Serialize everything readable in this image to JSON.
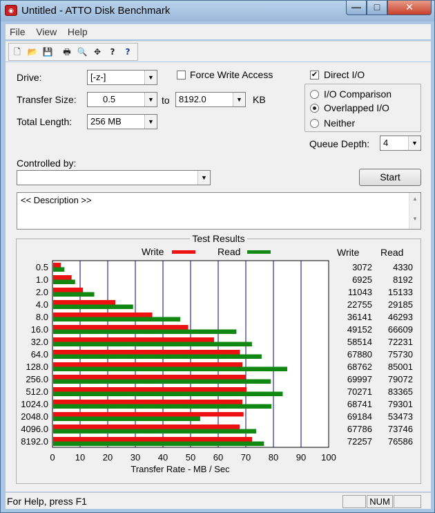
{
  "window": {
    "title": "Untitled - ATTO Disk Benchmark",
    "controls": {
      "minimize": "—",
      "maximize": "□",
      "close": "✕"
    }
  },
  "menu": [
    {
      "label": "File"
    },
    {
      "label": "View"
    },
    {
      "label": "Help"
    }
  ],
  "toolbar": {
    "buttons": [
      {
        "icon": "new-document-icon",
        "glyph": "🗋"
      },
      {
        "icon": "open-folder-icon",
        "glyph": "📂"
      },
      {
        "icon": "save-icon",
        "glyph": "💾"
      },
      {
        "icon": "print-icon",
        "glyph": "🖶"
      },
      {
        "icon": "print-preview-icon",
        "glyph": "🔍"
      },
      {
        "icon": "move-icon",
        "glyph": "✥"
      },
      {
        "icon": "help-icon",
        "glyph": "?"
      },
      {
        "icon": "context-help-icon",
        "glyph": "?"
      }
    ]
  },
  "form": {
    "drive_label": "Drive:",
    "drive_value": "[-z-]",
    "force_write_label": "Force Write Access",
    "force_write_checked": false,
    "direct_io_label": "Direct I/O",
    "direct_io_checked": true,
    "transfer_size_label": "Transfer Size:",
    "transfer_from": "0.5",
    "to_label": "to",
    "transfer_to": "8192.0",
    "kb_label": "KB",
    "total_length_label": "Total Length:",
    "total_length_value": "256 MB",
    "io_options": [
      {
        "label": "I/O Comparison",
        "selected": false
      },
      {
        "label": "Overlapped I/O",
        "selected": true
      },
      {
        "label": "Neither",
        "selected": false
      }
    ],
    "queue_depth_label": "Queue Depth:",
    "queue_depth_value": "4",
    "controlled_by_label": "Controlled by:",
    "controlled_by_value": "",
    "start_label": "Start",
    "description": "<< Description >>"
  },
  "results": {
    "title": "Test Results",
    "write_col": "Write",
    "read_col": "Read"
  },
  "chart_data": {
    "type": "bar",
    "orientation": "horizontal",
    "title": "Test Results",
    "xlabel": "Transfer Rate - MB / Sec",
    "xlim": [
      0,
      100
    ],
    "xticks": [
      0,
      10,
      20,
      30,
      40,
      50,
      60,
      70,
      80,
      90,
      100
    ],
    "grid": true,
    "legend_placement": "top",
    "categories": [
      "0.5",
      "1.0",
      "2.0",
      "4.0",
      "8.0",
      "16.0",
      "32.0",
      "64.0",
      "128.0",
      "256.0",
      "512.0",
      "1024.0",
      "2048.0",
      "4096.0",
      "8192.0"
    ],
    "series": [
      {
        "name": "Write",
        "color": "#ee1111",
        "values": [
          3072,
          6925,
          11043,
          22755,
          36141,
          49152,
          58514,
          67880,
          68762,
          69997,
          70271,
          68741,
          69184,
          67786,
          72257
        ]
      },
      {
        "name": "Read",
        "color": "#118811",
        "values": [
          4330,
          8192,
          15133,
          29185,
          46293,
          66609,
          72231,
          75730,
          85001,
          79072,
          83365,
          79301,
          53473,
          73746,
          76586
        ]
      }
    ],
    "value_unit_divisor": 1000
  },
  "status": {
    "help_text": "For Help, press F1",
    "num": "NUM"
  },
  "colors": {
    "write": "#ee1111",
    "read": "#118811",
    "chart_bg": "#ffffff",
    "grid": "#000080"
  }
}
